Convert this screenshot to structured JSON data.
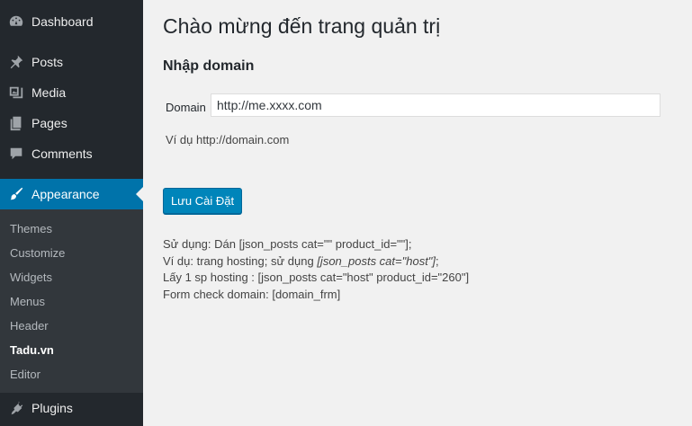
{
  "sidebar": {
    "items": [
      {
        "label": "Dashboard",
        "icon": "dashboard-icon"
      },
      {
        "label": "Posts",
        "icon": "pin-icon"
      },
      {
        "label": "Media",
        "icon": "media-icon"
      },
      {
        "label": "Pages",
        "icon": "pages-icon"
      },
      {
        "label": "Comments",
        "icon": "comment-icon"
      },
      {
        "label": "Appearance",
        "icon": "brush-icon",
        "active": true
      },
      {
        "label": "Plugins",
        "icon": "plugin-icon"
      }
    ],
    "submenu": [
      {
        "label": "Themes"
      },
      {
        "label": "Customize"
      },
      {
        "label": "Widgets"
      },
      {
        "label": "Menus"
      },
      {
        "label": "Header"
      },
      {
        "label": "Tadu.vn",
        "current": true
      },
      {
        "label": "Editor"
      }
    ],
    "colors": {
      "background": "#23282d",
      "active": "#0073aa",
      "submenu_bg": "#32373c"
    }
  },
  "main": {
    "title": "Chào mừng đến trang quản trị",
    "section_title": "Nhập domain",
    "domain_label": "Domain",
    "domain_value": "http://me.xxxx.com",
    "example": "Ví dụ http://domain.com",
    "save_button": "Lưu Cài Đặt",
    "usage": {
      "line1": "Sử dụng: Dán [json_posts cat=\"\" product_id=\"\"];",
      "line2_prefix": "Ví dụ: trang hosting; sử dụng ",
      "line2_italic": "[json_posts cat=\"host\"]",
      "line2_suffix": ";",
      "line3": "Lấy 1 sp hosting : [json_posts cat=\"host\" product_id=\"260\"]",
      "line4": "Form check domain: [domain_frm]"
    }
  }
}
